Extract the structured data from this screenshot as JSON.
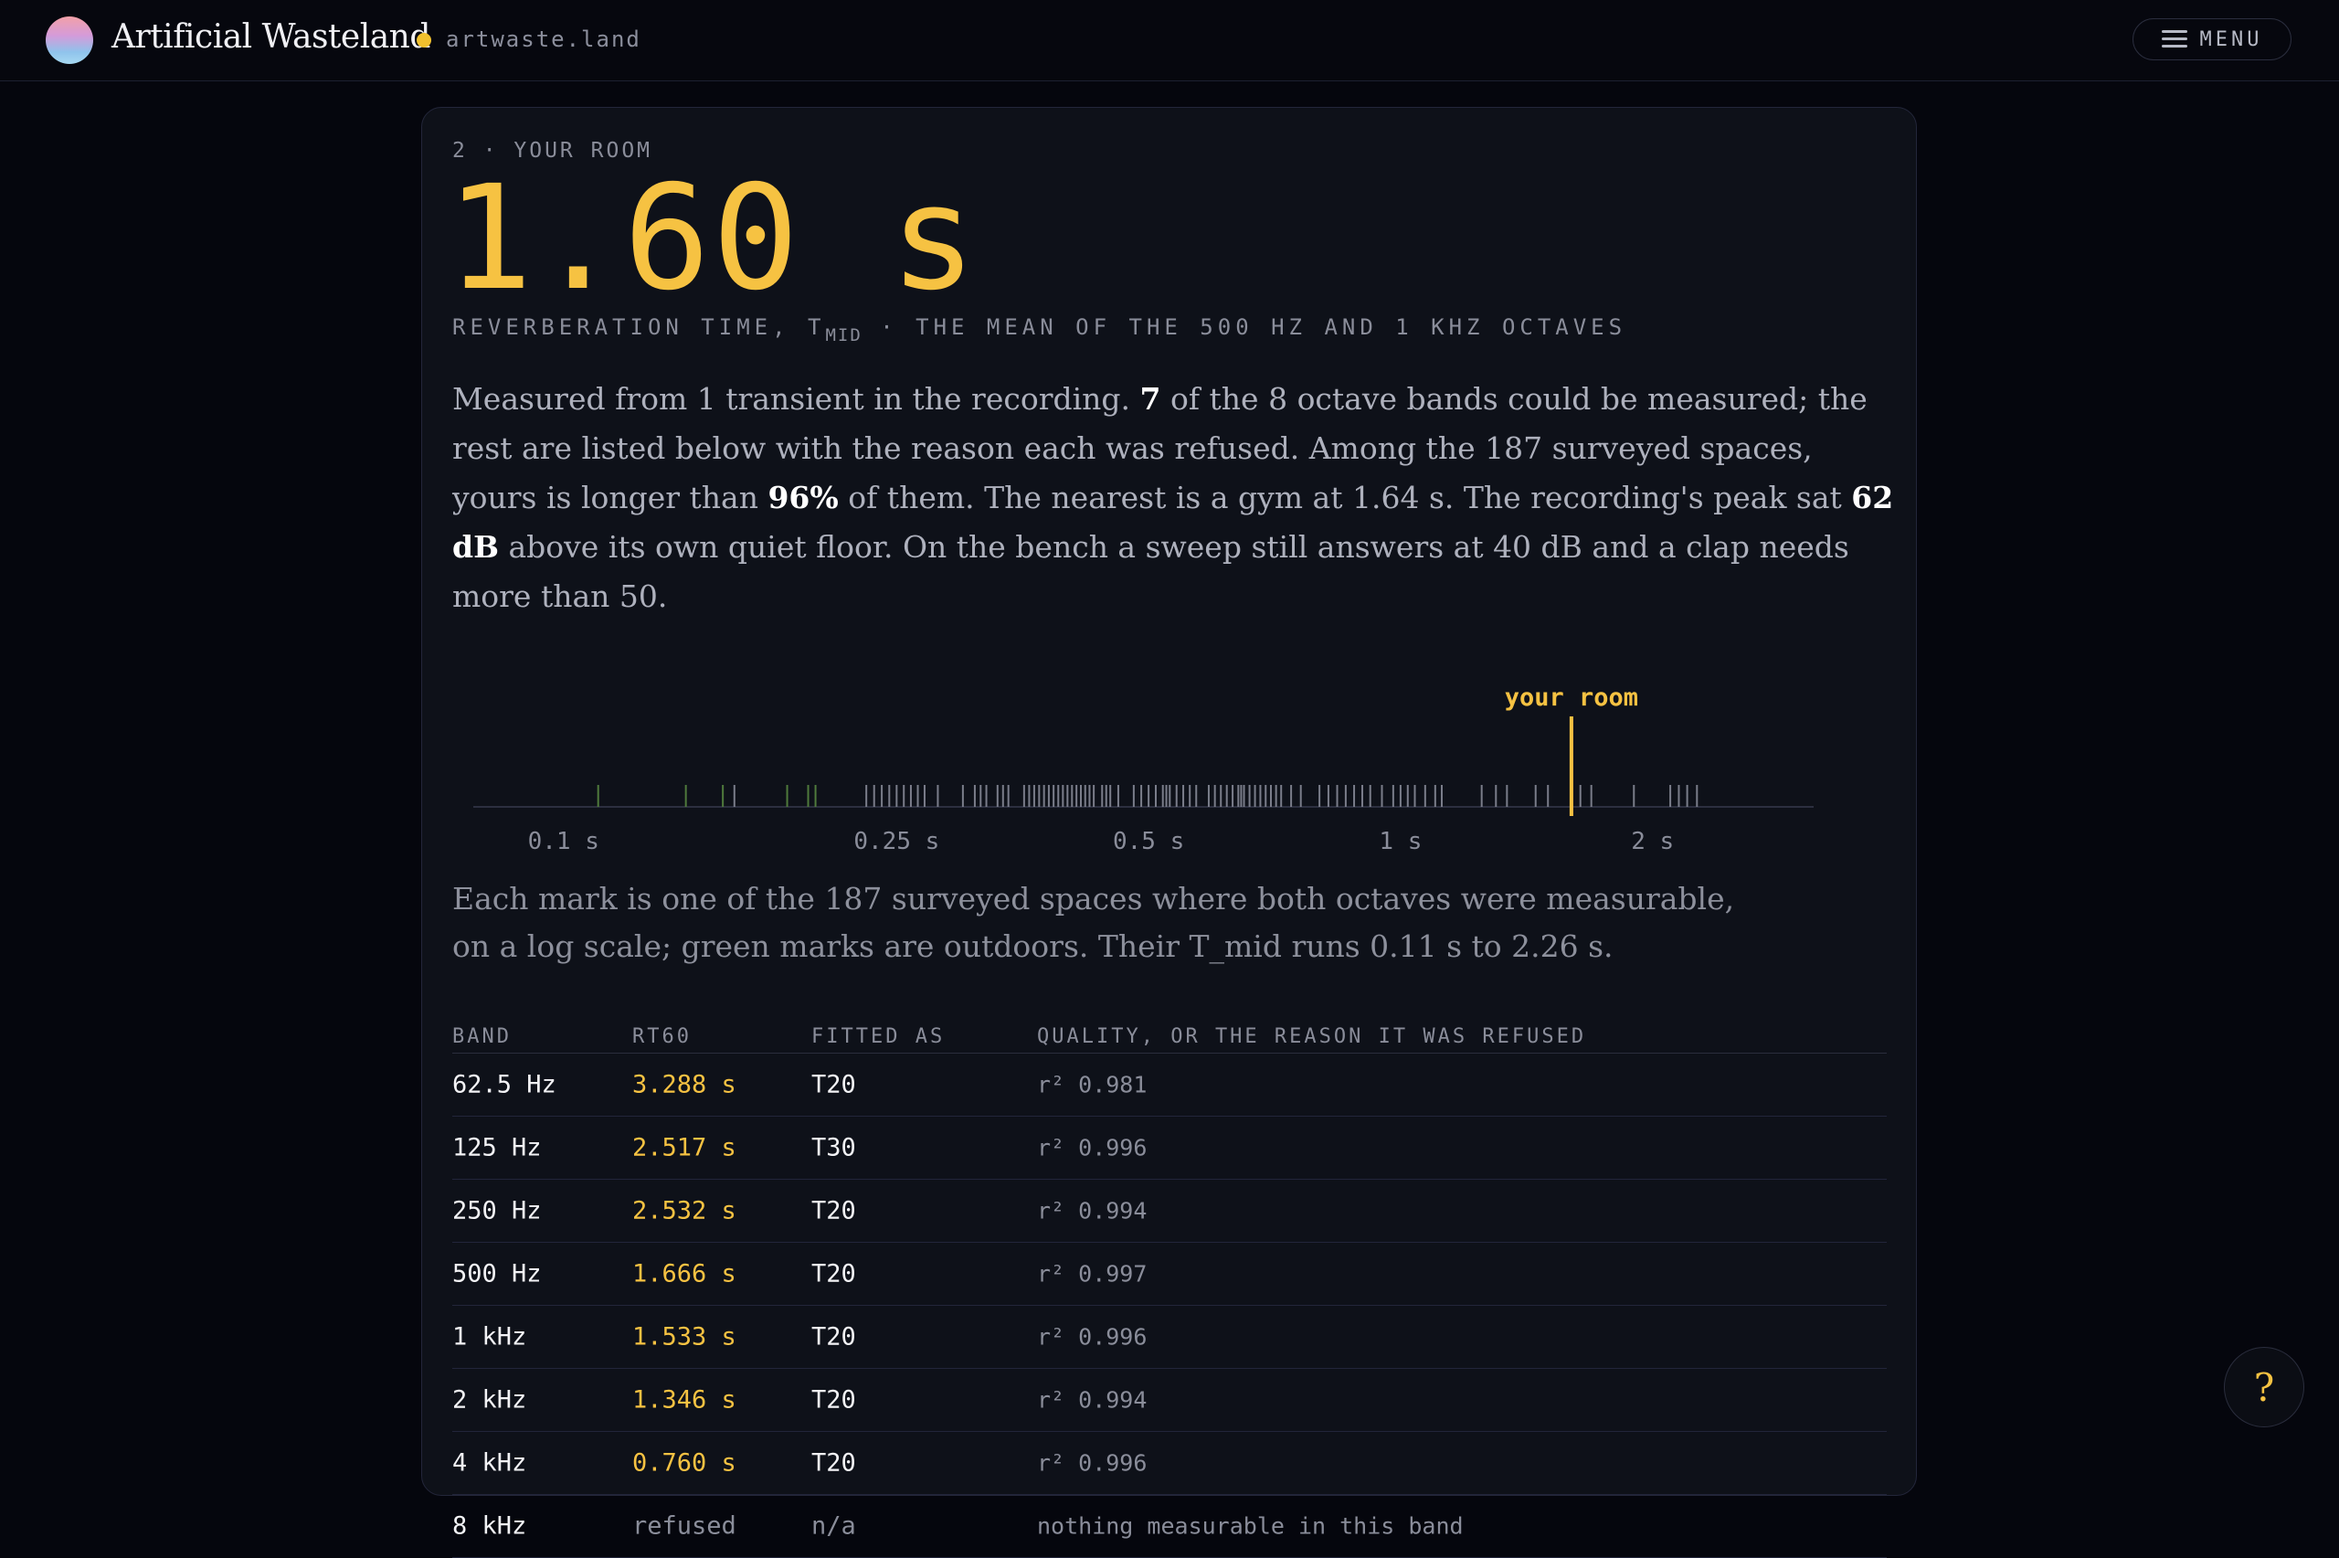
{
  "header": {
    "brand": "Artificial Wasteland",
    "domain": "artwaste.land",
    "menu_label": "MENU"
  },
  "result": {
    "eyebrow": "2 · YOUR ROOM",
    "value": "1.60 s",
    "sub_prefix": "REVERBERATION TIME, T",
    "sub_subscript": "MID",
    "sub_suffix": " · THE MEAN OF THE 500 HZ AND 1 KHZ OCTAVES",
    "para": [
      {
        "t": "Measured from 1 transient in the recording. ",
        "b": false
      },
      {
        "t": "7",
        "b": true
      },
      {
        "t": " of the 8 octave bands could be measured; the rest are listed below with the reason each was refused. Among the 187 surveyed spaces, yours is longer than ",
        "b": false
      },
      {
        "t": "96%",
        "b": true
      },
      {
        "t": " of them. The nearest is a gym at 1.64 s. The recording's peak sat ",
        "b": false
      },
      {
        "t": "62 dB",
        "b": true
      },
      {
        "t": " above its own quiet floor. On the bench a sweep still answers at 40 dB and a clap needs more than 50.",
        "b": false
      }
    ],
    "caption": "Each mark is one of the 187 surveyed spaces where both octaves were measurable, on a log scale; green marks are outdoors. Their T_mid runs 0.11 s to 2.26 s."
  },
  "chart_data": {
    "type": "strip",
    "scale": "log",
    "xlim": [
      0.08,
      3.0
    ],
    "ticks": [
      {
        "v": 0.1,
        "label": "0.1 s"
      },
      {
        "v": 0.25,
        "label": "0.25 s"
      },
      {
        "v": 0.5,
        "label": "0.5 s"
      },
      {
        "v": 1,
        "label": "1 s"
      },
      {
        "v": 2,
        "label": "2 s"
      }
    ],
    "marker": {
      "value": 1.6,
      "label": "your room"
    },
    "outdoor_values": [
      0.11,
      0.14,
      0.155,
      0.185,
      0.196,
      0.2
    ],
    "indoor_values": [
      0.16,
      0.23,
      0.235,
      0.24,
      0.245,
      0.25,
      0.255,
      0.26,
      0.265,
      0.27,
      0.28,
      0.3,
      0.31,
      0.315,
      0.32,
      0.33,
      0.335,
      0.34,
      0.355,
      0.36,
      0.365,
      0.37,
      0.375,
      0.38,
      0.385,
      0.39,
      0.395,
      0.4,
      0.405,
      0.41,
      0.415,
      0.42,
      0.425,
      0.43,
      0.44,
      0.445,
      0.45,
      0.46,
      0.48,
      0.49,
      0.5,
      0.51,
      0.52,
      0.525,
      0.53,
      0.54,
      0.55,
      0.56,
      0.57,
      0.59,
      0.6,
      0.61,
      0.62,
      0.63,
      0.64,
      0.645,
      0.65,
      0.66,
      0.67,
      0.68,
      0.69,
      0.7,
      0.71,
      0.72,
      0.74,
      0.76,
      0.8,
      0.82,
      0.84,
      0.86,
      0.88,
      0.9,
      0.92,
      0.95,
      0.98,
      1.0,
      1.02,
      1.04,
      1.07,
      1.1,
      1.12,
      1.25,
      1.3,
      1.34,
      1.45,
      1.5,
      1.64,
      1.69,
      1.9,
      2.1,
      2.15,
      2.2,
      2.26
    ]
  },
  "table": {
    "headers": [
      "BAND",
      "RT60",
      "FITTED AS",
      "QUALITY, OR THE REASON IT WAS REFUSED"
    ],
    "rows": [
      {
        "band": "62.5 Hz",
        "rt60": "3.288 s",
        "fit": "T20",
        "quality": "r² 0.981",
        "ok": true
      },
      {
        "band": "125 Hz",
        "rt60": "2.517 s",
        "fit": "T30",
        "quality": "r² 0.996",
        "ok": true
      },
      {
        "band": "250 Hz",
        "rt60": "2.532 s",
        "fit": "T20",
        "quality": "r² 0.994",
        "ok": true
      },
      {
        "band": "500 Hz",
        "rt60": "1.666 s",
        "fit": "T20",
        "quality": "r² 0.997",
        "ok": true
      },
      {
        "band": "1 kHz",
        "rt60": "1.533 s",
        "fit": "T20",
        "quality": "r² 0.996",
        "ok": true
      },
      {
        "band": "2 kHz",
        "rt60": "1.346 s",
        "fit": "T20",
        "quality": "r² 0.994",
        "ok": true
      },
      {
        "band": "4 kHz",
        "rt60": "0.760 s",
        "fit": "T20",
        "quality": "r² 0.996",
        "ok": true
      },
      {
        "band": "8 kHz",
        "rt60": "refused",
        "fit": "n/a",
        "quality": "nothing measurable in this band",
        "ok": false
      }
    ]
  },
  "help_label": "?",
  "colors": {
    "accent": "#f6c242",
    "outdoor": "#4f7a3c",
    "indoor": "#7a7d8a"
  }
}
